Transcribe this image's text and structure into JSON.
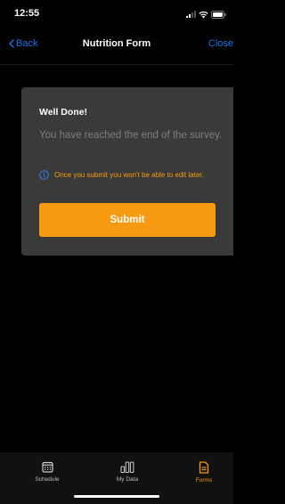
{
  "status": {
    "time": "12:55"
  },
  "nav": {
    "back_label": "Back",
    "title": "Nutrition Form",
    "close_label": "Close"
  },
  "card": {
    "title": "Well Done!",
    "body": "You have reached the end of the survey.",
    "warning": "Once you submit you won't be able to edit later.",
    "submit_label": "Submit"
  },
  "tabs": [
    {
      "label": "Schedule",
      "icon": "calendar-icon",
      "active": false
    },
    {
      "label": "My Data",
      "icon": "bar-chart-icon",
      "active": false
    },
    {
      "label": "Forms",
      "icon": "document-icon",
      "active": true
    }
  ],
  "colors": {
    "accent": "#f79a12",
    "link": "#1a73e8",
    "warning_text": "#f59e0b",
    "card_bg": "#3a3a3a",
    "background": "#000000"
  }
}
